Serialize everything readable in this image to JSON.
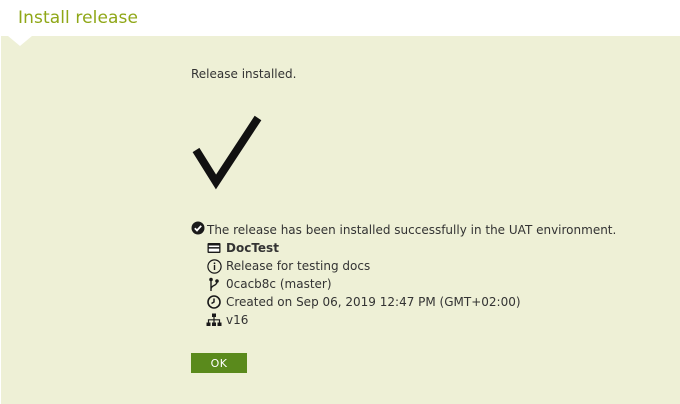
{
  "dialog": {
    "title": "Install release",
    "message": "Release installed.",
    "success_text": "The release has been installed successfully in the UAT environment.",
    "details": [
      {
        "icon": "card-icon",
        "text": "DocTest",
        "bold": true
      },
      {
        "icon": "info-icon",
        "text": "Release for testing docs"
      },
      {
        "icon": "branch-icon",
        "text": "0cacb8c (master)"
      },
      {
        "icon": "clock-icon",
        "text": "Created on Sep 06, 2019 12:47 PM (GMT+02:00)"
      },
      {
        "icon": "hierarchy-icon",
        "text": "v16"
      }
    ],
    "ok_label": "OK"
  },
  "colors": {
    "title": "#8fa717",
    "panel_bg": "#eef0d6",
    "button_bg": "#5a8a1c",
    "text": "#333333"
  }
}
